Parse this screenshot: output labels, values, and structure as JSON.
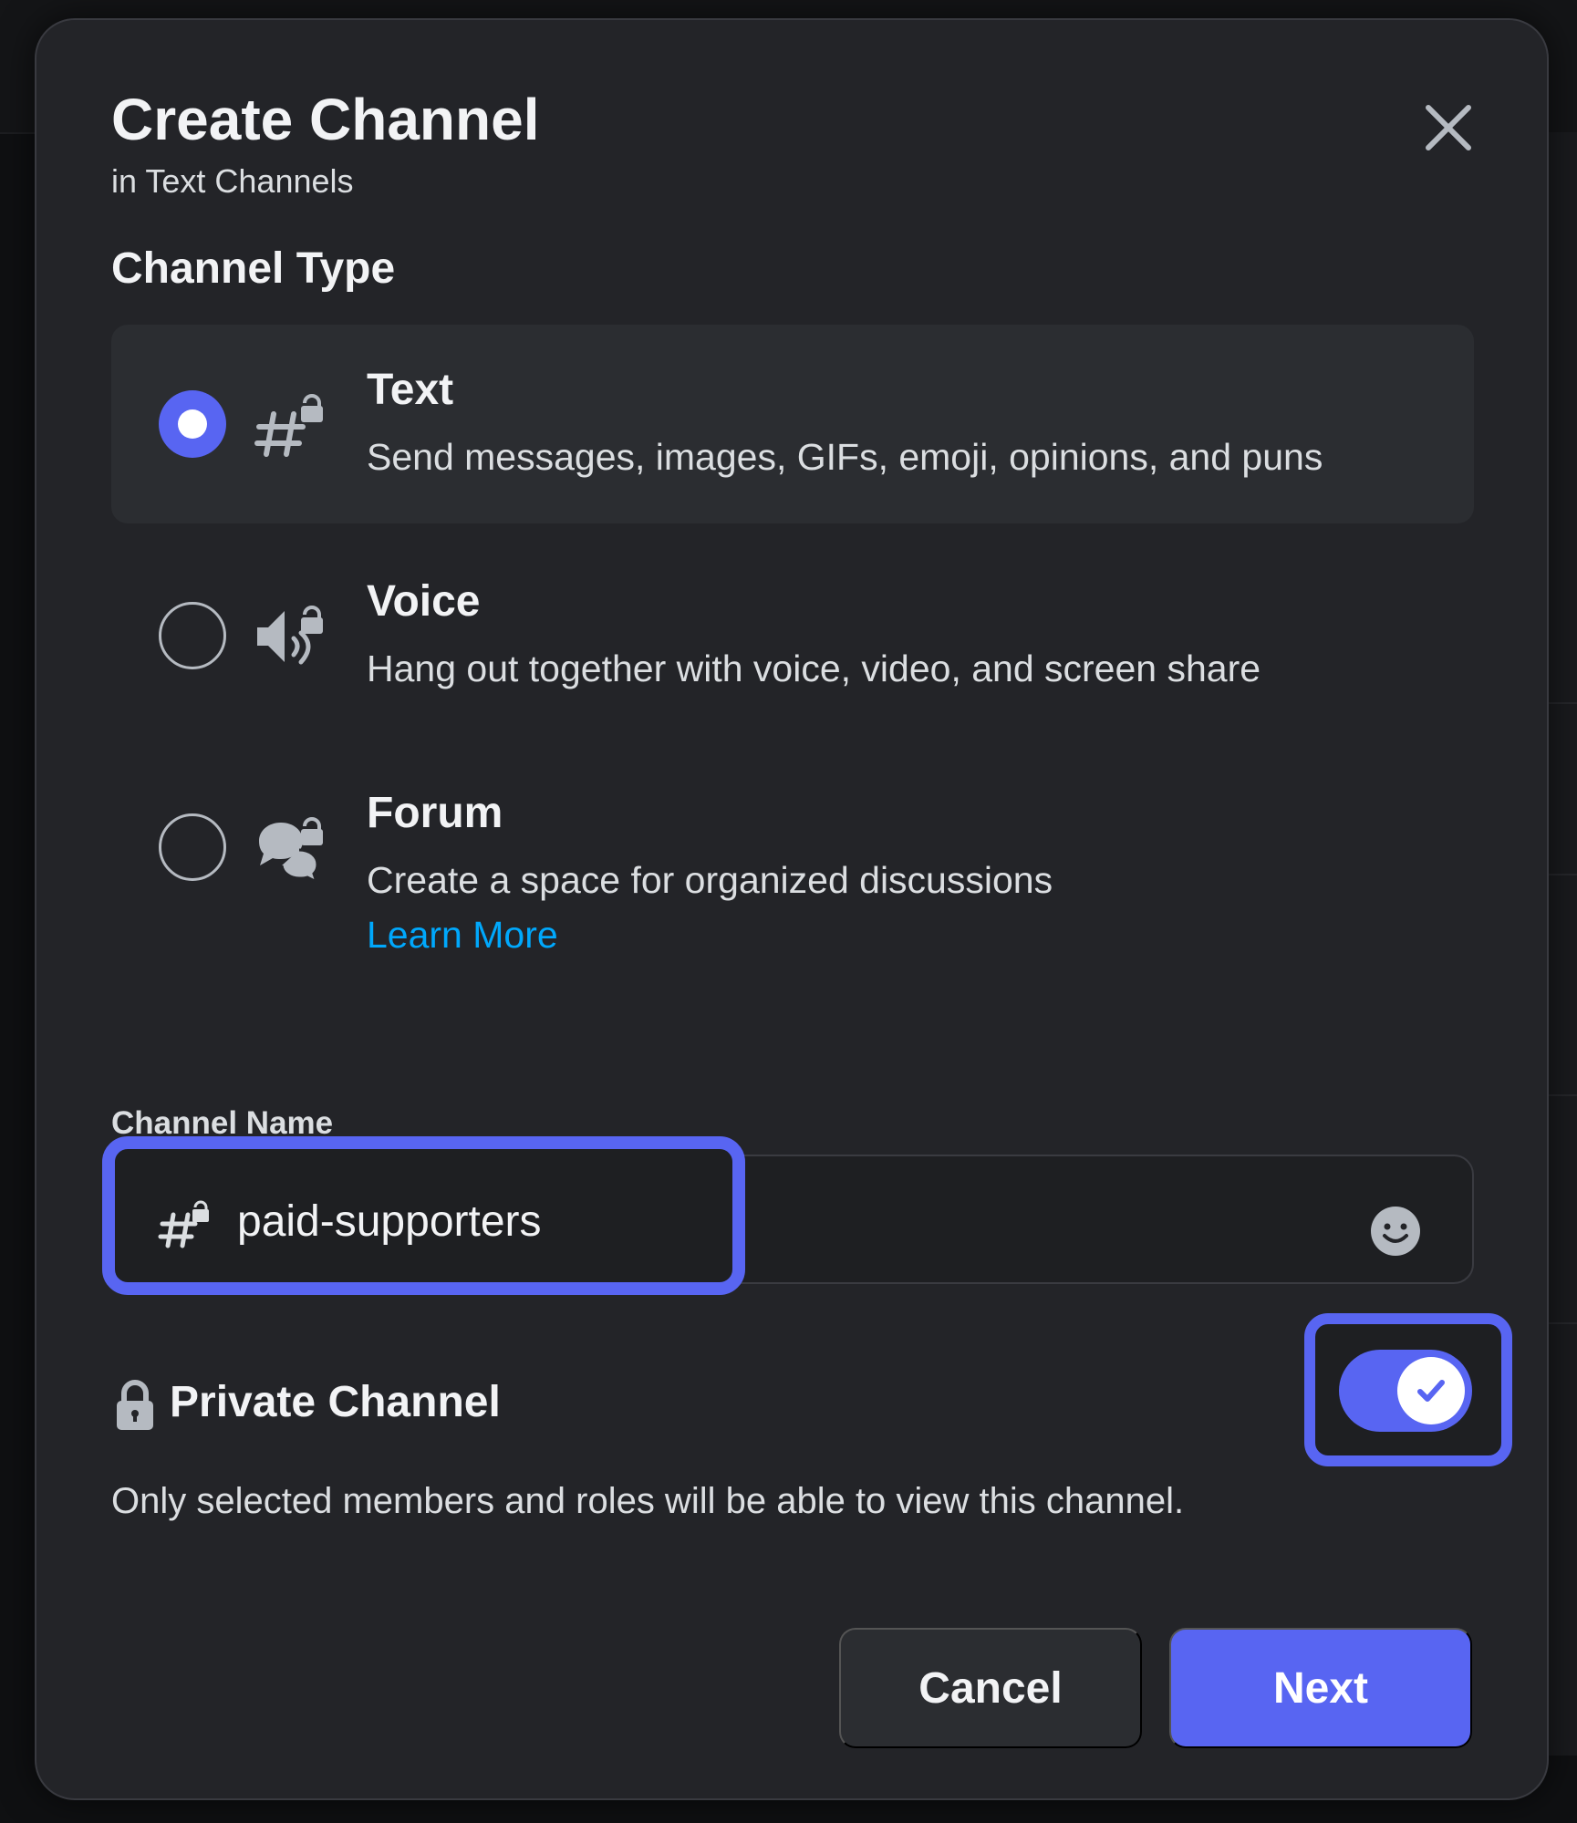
{
  "modal": {
    "title": "Create Channel",
    "subtitle": "in Text Channels",
    "close_icon": "close-icon"
  },
  "channel_type": {
    "label": "Channel Type",
    "options": [
      {
        "name": "Text",
        "description": "Send messages, images, GIFs, emoji, opinions, and puns",
        "icon": "hash-lock-icon",
        "selected": true
      },
      {
        "name": "Voice",
        "description": "Hang out together with voice, video, and screen share",
        "icon": "speaker-lock-icon",
        "selected": false
      },
      {
        "name": "Forum",
        "description": "Create a space for organized discussions",
        "link": "Learn More",
        "icon": "forum-lock-icon",
        "selected": false
      }
    ]
  },
  "channel_name": {
    "label": "Channel Name",
    "value": "paid-supporters",
    "prefix_icon": "hash-lock-icon",
    "emoji_icon": "emoji-icon"
  },
  "private_channel": {
    "label": "Private Channel",
    "description": "Only selected members and roles will be able to view this channel.",
    "enabled": true,
    "icon": "lock-icon"
  },
  "buttons": {
    "cancel": "Cancel",
    "next": "Next"
  },
  "colors": {
    "accent": "#5865f2",
    "link": "#00a8fc",
    "modal_bg": "#232428",
    "selected_bg": "#2b2d31"
  }
}
